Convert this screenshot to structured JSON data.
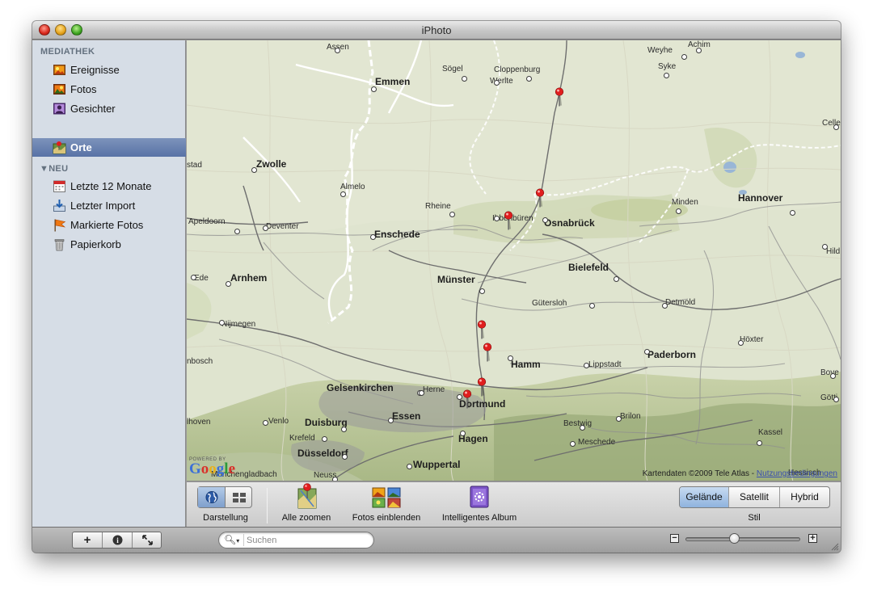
{
  "window": {
    "title": "iPhoto"
  },
  "sidebar": {
    "sections": [
      {
        "title": "MEDIATHEK",
        "items": [
          {
            "label": "Ereignisse",
            "icon": "events-icon"
          },
          {
            "label": "Fotos",
            "icon": "photos-icon"
          },
          {
            "label": "Gesichter",
            "icon": "faces-icon"
          },
          {
            "label": "Orte",
            "icon": "places-icon",
            "selected": true
          }
        ]
      },
      {
        "title": "NEU",
        "items": [
          {
            "label": "Letzte 12 Monate",
            "icon": "calendar-icon"
          },
          {
            "label": "Letzter Import",
            "icon": "import-icon"
          },
          {
            "label": "Markierte Fotos",
            "icon": "flag-icon"
          },
          {
            "label": "Papierkorb",
            "icon": "trash-icon"
          }
        ]
      }
    ]
  },
  "map": {
    "cities": [
      {
        "name": "Assen"
      },
      {
        "name": "Emmen"
      },
      {
        "name": "Sögel"
      },
      {
        "name": "Cloppenburg"
      },
      {
        "name": "Werlte"
      },
      {
        "name": "Achim"
      },
      {
        "name": "Weyhe"
      },
      {
        "name": "Syke"
      },
      {
        "name": "Celle"
      },
      {
        "name": "stad"
      },
      {
        "name": "Zwolle"
      },
      {
        "name": "Almelo"
      },
      {
        "name": "Rheine"
      },
      {
        "name": "Ibbenbüren"
      },
      {
        "name": "Osnabrück"
      },
      {
        "name": "Minden"
      },
      {
        "name": "Hannover"
      },
      {
        "name": "Apeldoorn"
      },
      {
        "name": "Deventer"
      },
      {
        "name": "Enschede"
      },
      {
        "name": "Bielefeld"
      },
      {
        "name": "Hild"
      },
      {
        "name": "Edе"
      },
      {
        "name": "Arnhem"
      },
      {
        "name": "Münster"
      },
      {
        "name": "Gütersloh"
      },
      {
        "name": "Detmold"
      },
      {
        "name": "Nijmegen"
      },
      {
        "name": "Höxter"
      },
      {
        "name": "nbosch"
      },
      {
        "name": "Hamm"
      },
      {
        "name": "Lippstadt"
      },
      {
        "name": "Paderborn"
      },
      {
        "name": "Bove"
      },
      {
        "name": "Gelsenkirchen"
      },
      {
        "name": "Herne"
      },
      {
        "name": "Dortmund"
      },
      {
        "name": "Götti"
      },
      {
        "name": "lhoven"
      },
      {
        "name": "Venlo"
      },
      {
        "name": "Duisburg"
      },
      {
        "name": "Essen"
      },
      {
        "name": "Bestwig"
      },
      {
        "name": "Brilon"
      },
      {
        "name": "Krefeld"
      },
      {
        "name": "Hagen"
      },
      {
        "name": "Meschede"
      },
      {
        "name": "Kassel"
      },
      {
        "name": "Düsseldorf"
      },
      {
        "name": "Wuppertal"
      },
      {
        "name": "Neuss"
      },
      {
        "name": "Mönchengladbach"
      },
      {
        "name": "Hessisch"
      }
    ],
    "pin_count": 7,
    "powered_by": "POWERED BY",
    "google": "Google",
    "attribution": "Kartendaten ©2009 Tele Atlas -",
    "attribution_link": "Nutzungsbedingungen"
  },
  "toolbar": {
    "view_label": "Darstellung",
    "zoom_all_label": "Alle zoomen",
    "show_photos_label": "Fotos einblenden",
    "smart_album_label": "Intelligentes Album",
    "style_label": "Stil",
    "style_options": [
      "Gelände",
      "Satellit",
      "Hybrid"
    ],
    "style_selected": "Gelände"
  },
  "bottombar": {
    "add_label": "+",
    "info_label": "i",
    "search_placeholder": "Suchen",
    "zoom_level": 0.42
  },
  "colors": {
    "accent": "#5872a6",
    "pin": "#e01e1e"
  }
}
